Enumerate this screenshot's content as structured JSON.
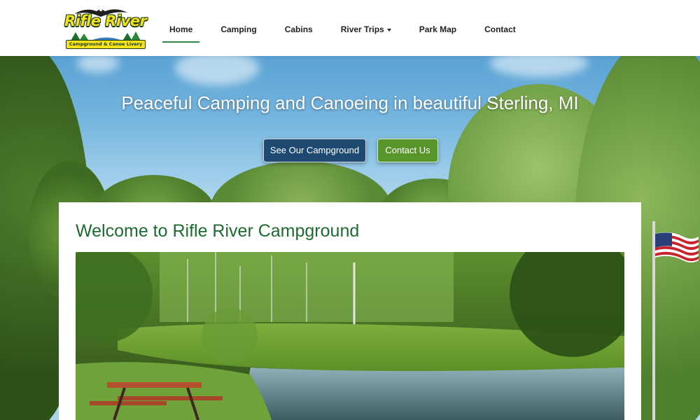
{
  "brand": {
    "name": "Rifle River",
    "tagline": "Campground & Canoe Livery"
  },
  "nav": {
    "items": [
      {
        "label": "Home",
        "active": true
      },
      {
        "label": "Camping",
        "active": false
      },
      {
        "label": "Cabins",
        "active": false
      },
      {
        "label": "River Trips",
        "active": false,
        "dropdown": true
      },
      {
        "label": "Park Map",
        "active": false
      },
      {
        "label": "Contact",
        "active": false
      }
    ]
  },
  "hero": {
    "headline": "Peaceful Camping and Canoeing in beautiful Sterling, MI",
    "primary_button": "See Our Campground",
    "secondary_button": "Contact Us"
  },
  "welcome": {
    "title": "Welcome to Rifle River Campground"
  },
  "colors": {
    "accent_green": "#2f8a44",
    "title_green": "#1d6b2f",
    "primary_button": "#1e4a72",
    "secondary_button": "#58962b",
    "logo_yellow": "#f5e21a"
  },
  "icons": {
    "logo_mark": "eagle-icon",
    "dropdown": "caret-down-icon",
    "flag": "american-flag-icon"
  }
}
